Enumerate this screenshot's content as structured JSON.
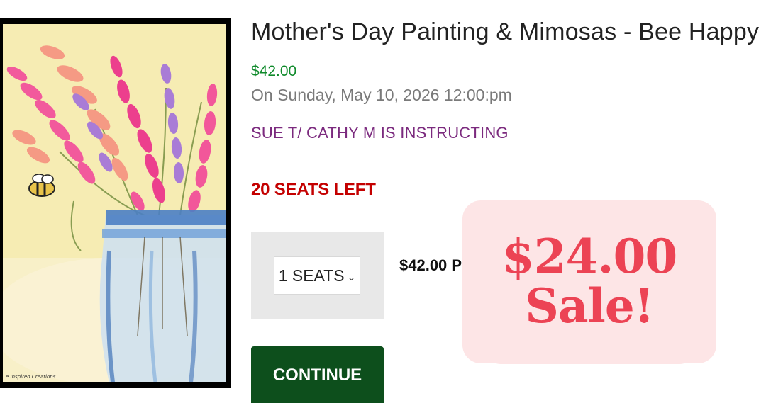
{
  "product": {
    "title": "Mother's Day Painting & Mimosas - Bee Happy",
    "price": "$42.00",
    "date": "On Sunday, May 10, 2026 12:00:pm",
    "instructor": "SUE T/ CATHY M IS INSTRUCTING",
    "seats_left": "20 SEATS LEFT",
    "image_signature": "e Inspired Creations"
  },
  "order": {
    "seats_selected": "1 SEATS",
    "line_price": "$42.00 P",
    "continue_label": "CONTINUE"
  },
  "promo": {
    "sale_price": "$24.00",
    "sale_label": "Sale!"
  },
  "colors": {
    "price_green": "#0f8a2b",
    "instructor_purple": "#7b2a7e",
    "seats_red": "#c40000",
    "continue_green": "#0d4f1c",
    "sale_red": "#ec4354",
    "sale_bg": "#fde5e6"
  }
}
